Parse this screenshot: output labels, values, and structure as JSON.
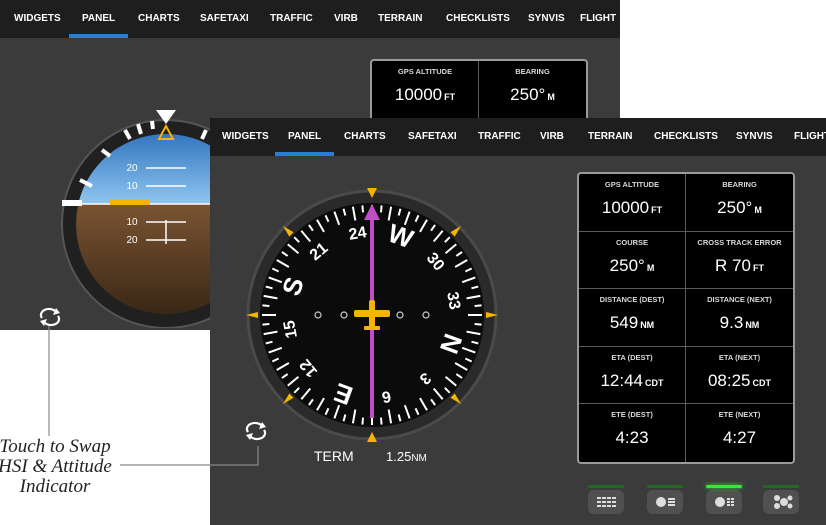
{
  "tabs": [
    "WIDGETS",
    "PANEL",
    "CHARTS",
    "SAFETAXI",
    "TRAFFIC",
    "VIRB",
    "TERRAIN",
    "CHECKLISTS",
    "SYNVIS",
    "FLIGHT"
  ],
  "active_tab": "PANEL",
  "back_screen": {
    "info": [
      {
        "label": "GPS ALTITUDE",
        "value": "10000",
        "unit": "FT"
      },
      {
        "label": "BEARING",
        "value": "250°",
        "unit": "M"
      }
    ],
    "pitch_labels": [
      "20",
      "10",
      "10",
      "20"
    ]
  },
  "front_screen": {
    "info": [
      {
        "label": "GPS ALTITUDE",
        "value": "10000",
        "unit": "FT"
      },
      {
        "label": "BEARING",
        "value": "250°",
        "unit": "M"
      },
      {
        "label": "COURSE",
        "value": "250°",
        "unit": "M"
      },
      {
        "label": "CROSS TRACK ERROR",
        "value": "R 70",
        "unit": "FT"
      },
      {
        "label": "DISTANCE (DEST)",
        "value": "549",
        "unit": "NM"
      },
      {
        "label": "DISTANCE (NEXT)",
        "value": "9.3",
        "unit": "NM"
      },
      {
        "label": "ETA (DEST)",
        "value": "12:44",
        "unit": "CDT"
      },
      {
        "label": "ETA (NEXT)",
        "value": "08:25",
        "unit": "CDT"
      },
      {
        "label": "ETE (DEST)",
        "value": "4:23",
        "unit": ""
      },
      {
        "label": "ETE (NEXT)",
        "value": "4:27",
        "unit": ""
      }
    ],
    "hsi_labels": [
      "24",
      "W",
      "30",
      "33",
      "N",
      "3",
      "E",
      "12",
      "15",
      "S",
      "21",
      "6"
    ],
    "cdi_mode": "TERM",
    "cdi_scale": "1.25",
    "cdi_scale_unit": "NM",
    "layout_buttons": [
      "four-column-layout",
      "instrument-list-layout",
      "instrument-list-narrow-layout",
      "multi-instrument-layout"
    ],
    "selected_layout": 2
  },
  "callout_lines": [
    "Touch to Swap",
    "HSI & Attitude",
    "Indicator"
  ]
}
